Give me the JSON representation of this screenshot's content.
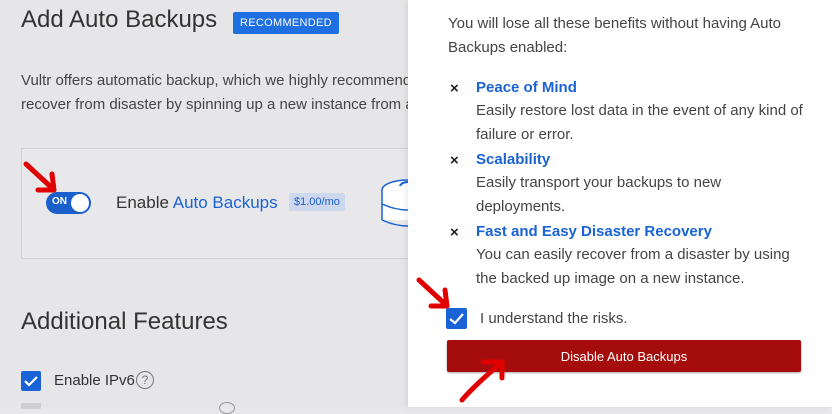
{
  "left": {
    "title": "Add Auto Backups",
    "badge": "RECOMMENDED",
    "intro_line1": "Vultr offers automatic backup, which we highly recommend",
    "intro_line2": "recover from disaster by spinning up a new instance from a",
    "toggle_text": "ON",
    "enable_prefix": "Enable ",
    "enable_link": "Auto Backups",
    "price": "$1.00/mo",
    "additional_title": "Additional Features",
    "ipv6_label": "Enable IPv6",
    "help_glyph": "?"
  },
  "panel": {
    "warning": "You will lose all these benefits without having Auto Backups enabled:",
    "x_glyph": "×",
    "benefits": [
      {
        "title": "Peace of Mind",
        "desc": "Easily restore lost data in the event of any kind of failure or error."
      },
      {
        "title": "Scalability",
        "desc": "Easily transport your backups to new deployments."
      },
      {
        "title": "Fast and Easy Disaster Recovery",
        "desc": "You can easily recover from a disaster by using the backed up image on a new instance."
      }
    ],
    "risk_label": "I understand the risks.",
    "disable_button": "Disable Auto Backups"
  },
  "colors": {
    "accent": "#1a63d6",
    "danger": "#a50c0c",
    "annotation": "#e00000"
  }
}
